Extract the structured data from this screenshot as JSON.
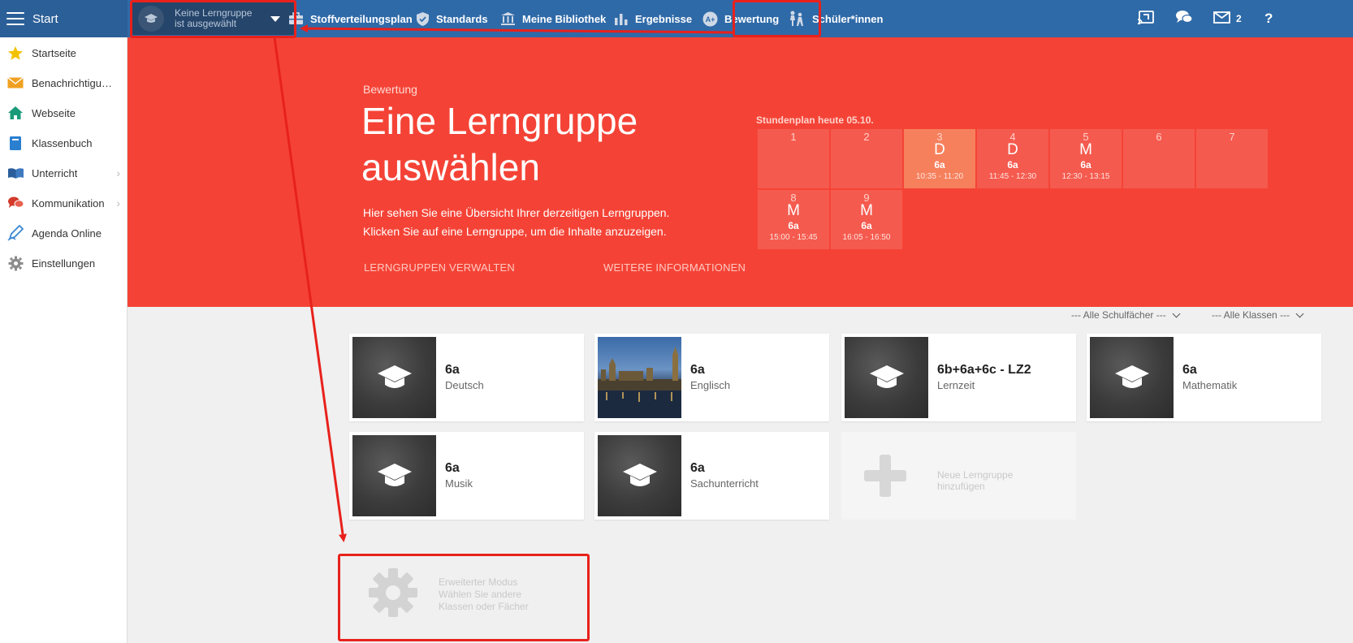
{
  "topbar": {
    "start_label": "Start",
    "group_select": {
      "line1": "Keine Lerngruppe",
      "line2": "ist ausgewählt"
    },
    "nav": [
      {
        "label": "Stoffverteilungsplan",
        "icon": "briefcase-icon"
      },
      {
        "label": "Standards",
        "icon": "shield-check-icon"
      },
      {
        "label": "Meine Bibliothek",
        "icon": "library-icon"
      },
      {
        "label": "Ergebnisse",
        "icon": "bar-chart-icon"
      },
      {
        "label": "Bewertung",
        "icon": "grading-icon"
      },
      {
        "label": "Schüler*innen",
        "icon": "students-icon"
      }
    ],
    "message_count": "2",
    "help": "?"
  },
  "sidebar": {
    "items": [
      {
        "label": "Startseite",
        "icon": "star-icon"
      },
      {
        "label": "Benachrichtigungen",
        "icon": "envelope-icon"
      },
      {
        "label": "Webseite",
        "icon": "home-icon"
      },
      {
        "label": "Klassenbuch",
        "icon": "notebook-icon"
      },
      {
        "label": "Unterricht",
        "icon": "open-book-icon"
      },
      {
        "label": "Kommunikation",
        "icon": "chat-icon"
      },
      {
        "label": "Agenda Online",
        "icon": "pen-icon"
      },
      {
        "label": "Einstellungen",
        "icon": "gear-icon"
      }
    ]
  },
  "hero": {
    "section": "Bewertung",
    "title": "Eine Lerngruppe auswählen",
    "desc_line1": "Hier sehen Sie eine Übersicht Ihrer derzeitigen Lerngruppen.",
    "desc_line2": "Klicken Sie auf eine Lerngruppe, um die Inhalte anzuzeigen.",
    "link_manage": "LERNGRUPPEN VERWALTEN",
    "link_info": "WEITERE INFORMATIONEN"
  },
  "schedule": {
    "title": "Stundenplan heute 05.10.",
    "slots": [
      {
        "num": "1",
        "subject": "",
        "class": "",
        "time": ""
      },
      {
        "num": "2",
        "subject": "",
        "class": "",
        "time": ""
      },
      {
        "num": "3",
        "subject": "D",
        "class": "6a",
        "time": "10:35 - 11:20"
      },
      {
        "num": "4",
        "subject": "D",
        "class": "6a",
        "time": "11:45 - 12:30"
      },
      {
        "num": "5",
        "subject": "M",
        "class": "6a",
        "time": "12:30 - 13:15"
      },
      {
        "num": "6",
        "subject": "",
        "class": "",
        "time": ""
      },
      {
        "num": "7",
        "subject": "",
        "class": "",
        "time": ""
      },
      {
        "num": "8",
        "subject": "M",
        "class": "6a",
        "time": "15:00 - 15:45"
      },
      {
        "num": "9",
        "subject": "M",
        "class": "6a",
        "time": "16:05 - 16:50"
      }
    ]
  },
  "filters": {
    "subjects": "--- Alle Schulfächer ---",
    "classes": "--- Alle Klassen ---"
  },
  "cards": [
    {
      "title": "6a",
      "subtitle": "Deutsch"
    },
    {
      "title": "6a",
      "subtitle": "Englisch"
    },
    {
      "title": "6b+6a+6c - LZ2",
      "subtitle": "Lernzeit"
    },
    {
      "title": "6a",
      "subtitle": "Mathematik"
    },
    {
      "title": "6a",
      "subtitle": "Musik"
    },
    {
      "title": "6a",
      "subtitle": "Sachunterricht"
    }
  ],
  "add_group": {
    "line1": "Neue Lerngruppe",
    "line2": "hinzufügen"
  },
  "advanced": {
    "line1": "Erweiterter Modus",
    "line2": "Wählen Sie andere",
    "line3": "Klassen oder Fächer"
  },
  "colors": {
    "topbar": "#2f6aa8",
    "hero": "#f44336",
    "annotation": "#e8211c"
  }
}
